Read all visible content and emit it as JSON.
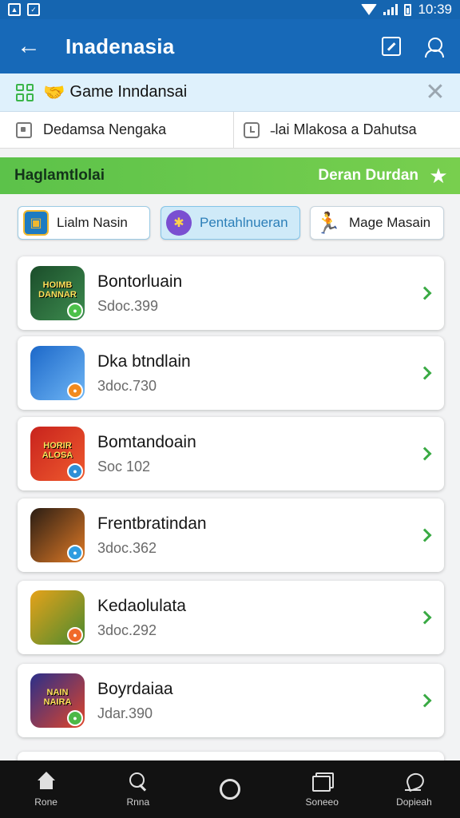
{
  "status": {
    "time": "10:39"
  },
  "appbar": {
    "title": "Inadenasia"
  },
  "search_chip": {
    "text": "Game Inndansai"
  },
  "filters": [
    {
      "label": "Dedamsa Nengaka",
      "icon": "box-icon"
    },
    {
      "label": "˗lai Mlakosa a Dahutsa",
      "icon": "clock-icon"
    }
  ],
  "banner": {
    "left": "Haglamtlolai",
    "right": "Deran Durdan"
  },
  "categories": [
    {
      "label": "Lialm Nasin",
      "icon": "game-card-icon",
      "selected": false
    },
    {
      "label": "Pentahlnueran",
      "icon": "controller-icon",
      "selected": true
    },
    {
      "label": "Mage Masain",
      "icon": "runner-icon",
      "selected": false
    }
  ],
  "games": [
    {
      "title": "Bontorluain",
      "subtitle": "Sdoc.399",
      "thumb_text": "HOIMB DANNAR",
      "colors": [
        "#1b4d2a",
        "#3d8c4f"
      ],
      "badge": "#4cc14a"
    },
    {
      "title": "Dka btndlain",
      "subtitle": "3doc.730",
      "thumb_text": "",
      "colors": [
        "#1c68c9",
        "#6fb6f5"
      ],
      "badge": "#f28a1e"
    },
    {
      "title": "Bomtandoain",
      "subtitle": "Soc 102",
      "thumb_text": "HORIR ALOSA",
      "colors": [
        "#c8231d",
        "#ef5a2e"
      ],
      "badge": "#2e8fd6"
    },
    {
      "title": "Frentbratindan",
      "subtitle": "3doc.362",
      "thumb_text": "",
      "colors": [
        "#2a1d14",
        "#e07a26"
      ],
      "badge": "#2f9ce0"
    },
    {
      "title": "Kedaolulata",
      "subtitle": "3doc.292",
      "thumb_text": "",
      "colors": [
        "#e5a21a",
        "#4a8a2f"
      ],
      "badge": "#f06a2a"
    },
    {
      "title": "Boyrdaiaa",
      "subtitle": "Jdar.390",
      "thumb_text": "NAIN NAIRA",
      "colors": [
        "#2a2f8a",
        "#e0452a"
      ],
      "badge": "#4cb847"
    }
  ],
  "nav": [
    {
      "label": "Rone",
      "icon": "home-icon"
    },
    {
      "label": "Rnna",
      "icon": "search-icon"
    },
    {
      "label": "",
      "icon": "circle-icon"
    },
    {
      "label": "Soneeo",
      "icon": "stack-icon"
    },
    {
      "label": "Dopieah",
      "icon": "leaf-icon"
    }
  ]
}
